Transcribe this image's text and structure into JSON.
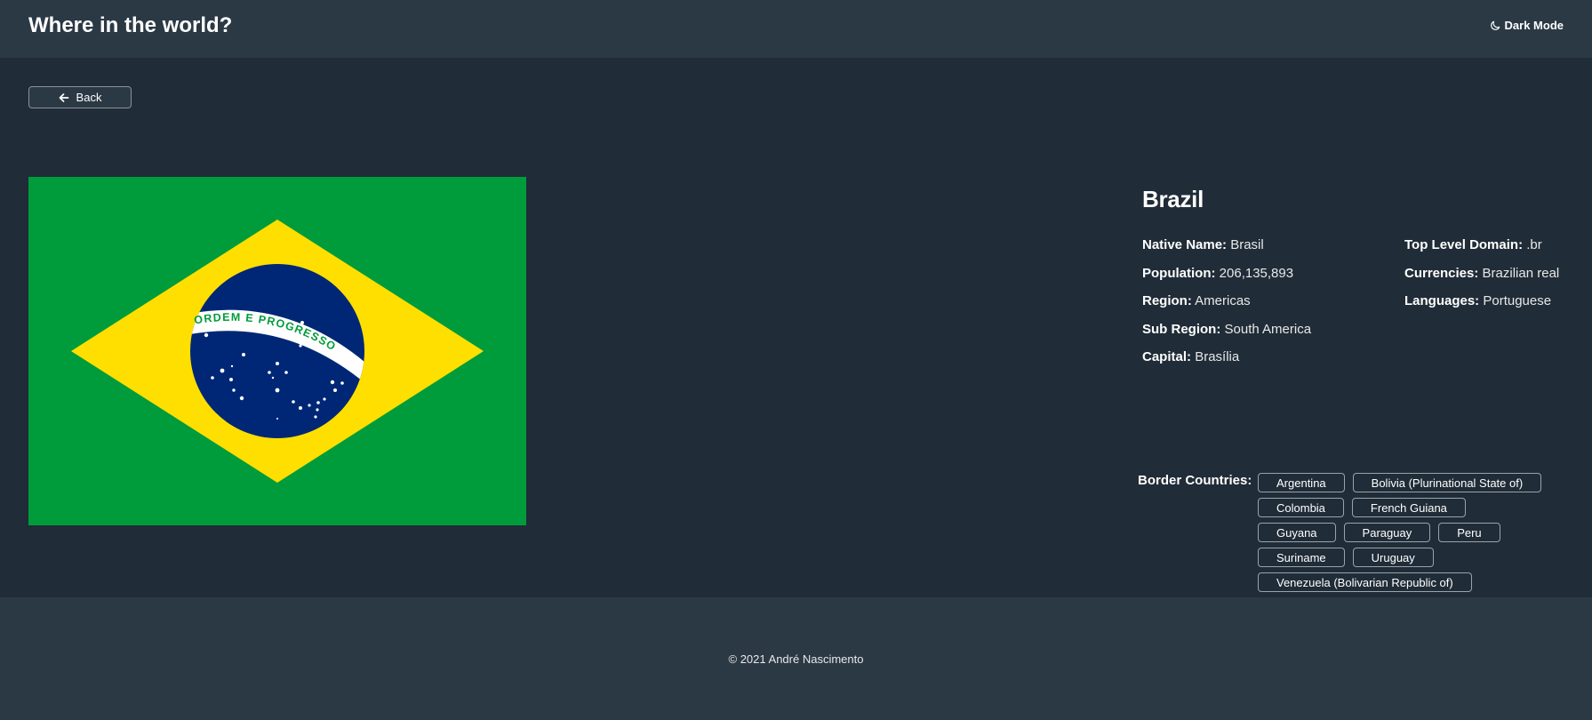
{
  "header": {
    "title": "Where in the world?",
    "dark_mode_label": "Dark Mode",
    "dark_mode_icon": "moon-icon"
  },
  "back_button": {
    "label": "Back",
    "icon": "arrow-left-icon"
  },
  "flag": {
    "motto": "ORDEM E PROGRESSO",
    "colors": {
      "green": "#009c3b",
      "yellow": "#ffdf00",
      "blue": "#002776",
      "white": "#ffffff"
    }
  },
  "country": {
    "name": "Brazil",
    "native_name_label": "Native Name:",
    "native_name": "Brasil",
    "population_label": "Population:",
    "population": "206,135,893",
    "region_label": "Region:",
    "region": "Americas",
    "subregion_label": "Sub Region:",
    "subregion": "South America",
    "capital_label": "Capital:",
    "capital": "Brasília",
    "tld_label": "Top Level Domain:",
    "tld": ".br",
    "currencies_label": "Currencies:",
    "currencies": "Brazilian real",
    "languages_label": "Languages:",
    "languages": "Portuguese"
  },
  "borders": {
    "label": "Border Countries:",
    "countries": [
      "Argentina",
      "Bolivia (Plurinational State of)",
      "Colombia",
      "French Guiana",
      "Guyana",
      "Paraguay",
      "Peru",
      "Suriname",
      "Uruguay",
      "Venezuela (Bolivarian Republic of)"
    ]
  },
  "footer": {
    "text": "© 2021 André Nascimento"
  },
  "colors": {
    "background": "#202c37",
    "elements": "#2b3945",
    "text": "#ffffff"
  }
}
